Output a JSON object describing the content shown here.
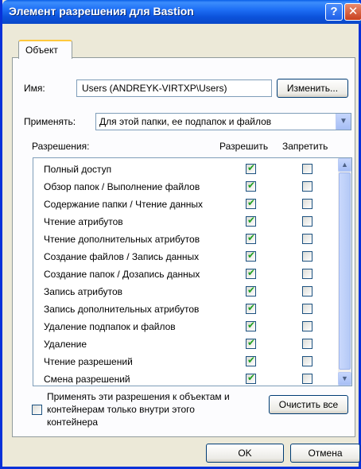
{
  "window": {
    "title": "Элемент разрешения для Bastion",
    "help_glyph": "?",
    "close_glyph": "✕"
  },
  "tab": {
    "label": "Объект"
  },
  "name_row": {
    "label": "Имя:",
    "value": "Users (ANDREYK-VIRTXP\\Users)",
    "change_button": "Изменить..."
  },
  "apply_row": {
    "label": "Применять:",
    "value": "Для этой папки, ее подпапок и файлов"
  },
  "permissions": {
    "header": "Разрешения:",
    "allow_header": "Разрешить",
    "deny_header": "Запретить",
    "items": [
      {
        "name": "Полный доступ",
        "allow": true,
        "deny": false
      },
      {
        "name": "Обзор папок / Выполнение файлов",
        "allow": true,
        "deny": false
      },
      {
        "name": "Содержание папки / Чтение данных",
        "allow": true,
        "deny": false
      },
      {
        "name": "Чтение атрибутов",
        "allow": true,
        "deny": false
      },
      {
        "name": "Чтение дополнительных атрибутов",
        "allow": true,
        "deny": false
      },
      {
        "name": "Создание файлов / Запись данных",
        "allow": true,
        "deny": false
      },
      {
        "name": "Создание папок / Дозапись данных",
        "allow": true,
        "deny": false
      },
      {
        "name": "Запись атрибутов",
        "allow": true,
        "deny": false
      },
      {
        "name": "Запись дополнительных атрибутов",
        "allow": true,
        "deny": false
      },
      {
        "name": "Удаление подпапок и файлов",
        "allow": true,
        "deny": false
      },
      {
        "name": "Удаление",
        "allow": true,
        "deny": false
      },
      {
        "name": "Чтение разрешений",
        "allow": true,
        "deny": false
      },
      {
        "name": "Смена разрешений",
        "allow": true,
        "deny": false
      }
    ]
  },
  "apply_inside": {
    "text": "Применять эти разрешения к объектам и контейнерам только внутри этого контейнера",
    "checked": false
  },
  "clear_button": "Очистить все",
  "ok_button": "OK",
  "cancel_button": "Отмена"
}
